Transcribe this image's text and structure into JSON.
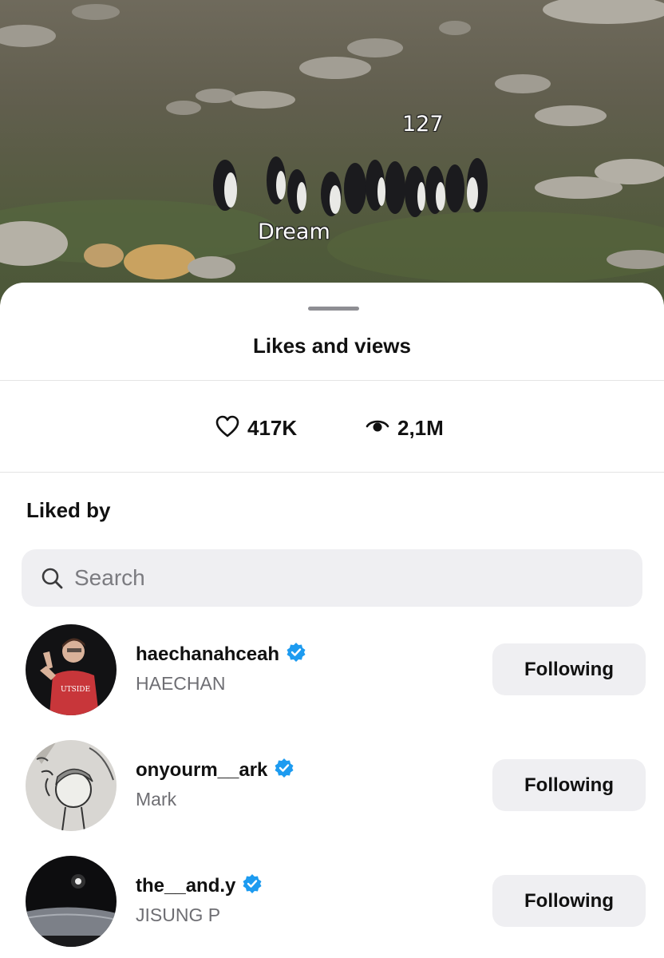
{
  "photo": {
    "overlay_labels": [
      "127",
      "Dream"
    ]
  },
  "sheet": {
    "title": "Likes and views"
  },
  "stats": {
    "likes": "417K",
    "views": "2,1M",
    "likes_icon": "heart-icon",
    "views_icon": "eye-icon"
  },
  "liked_by": {
    "heading": "Liked by",
    "search_placeholder": "Search",
    "users": [
      {
        "username": "haechanahceah",
        "name": "HAECHAN",
        "verified": true,
        "button": "Following"
      },
      {
        "username": "onyourm__ark",
        "name": "Mark",
        "verified": true,
        "button": "Following"
      },
      {
        "username": "the__and.y",
        "name": "JISUNG P",
        "verified": true,
        "button": "Following"
      }
    ]
  },
  "colors": {
    "verified_badge": "#1d9bf0",
    "button_bg": "#efeff2",
    "secondary_text": "#6e6e73"
  }
}
